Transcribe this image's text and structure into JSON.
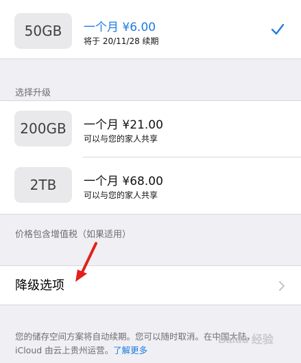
{
  "current_plan": {
    "size": "50GB",
    "price": "一个月 ¥6.00",
    "renew_note": "将于 20/11/28 续期",
    "selected_icon": "checkmark-icon"
  },
  "upgrade_section": {
    "header": "选择升级",
    "plans": [
      {
        "size": "200GB",
        "price": "一个月 ¥21.00",
        "note": "可以与您的家人共享"
      },
      {
        "size": "2TB",
        "price": "一个月 ¥68.00",
        "note": "可以与您的家人共享"
      }
    ]
  },
  "tax_note": "价格包含增值税（如果适用）",
  "downgrade": {
    "label": "降级选项",
    "icon": "chevron-right-icon"
  },
  "footer": {
    "line1": "您的储存空间方案将自动续期。您可以随时取消。在中国大陆，",
    "line2": "iCloud 由云上贵州运营。",
    "learn_more": "了解更多"
  },
  "watermark": "Baidu 经验",
  "colors": {
    "accent": "#1f7ce0",
    "background": "#efeff4",
    "annotation_arrow": "#e3201b"
  }
}
